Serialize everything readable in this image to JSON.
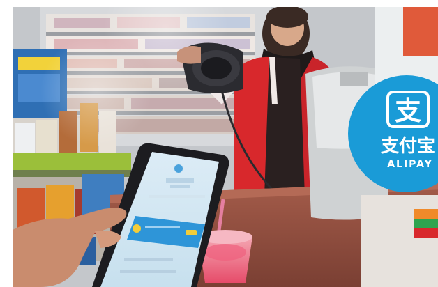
{
  "photo": {
    "scene": "checkout-counter",
    "sign": {
      "glyph": "支",
      "chinese": "支付宝",
      "latin": "ALIPAY",
      "color": "#1a9bd7"
    },
    "phone_screen_color": "#cfe6f3",
    "cashier_vest_color": "#d8282c"
  }
}
